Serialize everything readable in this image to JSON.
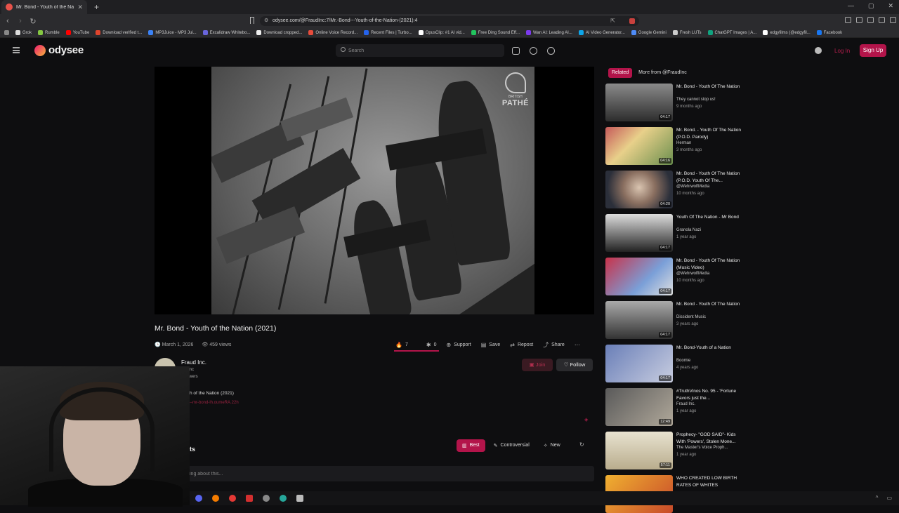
{
  "browser": {
    "tab_title": "Mr. Bond - Youth of the Natio",
    "url": "odysee.com/@FraudInc:7/Mr.-Bond---Youth-of-the-Nation-(2021):4",
    "bookmarks": [
      {
        "label": "Grok",
        "color": "#dddddd"
      },
      {
        "label": "Rumble",
        "color": "#85c742"
      },
      {
        "label": "YouTube",
        "color": "#ff0000"
      },
      {
        "label": "Download verified t...",
        "color": "#e0452d"
      },
      {
        "label": "MP3Juice - MP3 Jui...",
        "color": "#3b82f6"
      },
      {
        "label": "Excalidraw Whitebo...",
        "color": "#6965db"
      },
      {
        "label": "Download cropped...",
        "color": "#eeeeee"
      },
      {
        "label": "Online Voice Record...",
        "color": "#e74c3c"
      },
      {
        "label": "Recent Files | Turbo...",
        "color": "#2563eb"
      },
      {
        "label": "OpusClip: #1 AI vid...",
        "color": "#ffffff"
      },
      {
        "label": "Free Ding Sound Eff...",
        "color": "#22c55e"
      },
      {
        "label": "Wan AI: Leading AI...",
        "color": "#7c3aed"
      },
      {
        "label": "AI Video Generator...",
        "color": "#0ea5e9"
      },
      {
        "label": "Google Gemini",
        "color": "#4f8cf7"
      },
      {
        "label": "Fresh LUTs",
        "color": "#cccccc"
      },
      {
        "label": "ChatGPT Images | A...",
        "color": "#10a37f"
      },
      {
        "label": "edgyfilms (@edgyfil...",
        "color": "#ffffff"
      },
      {
        "label": "Facebook",
        "color": "#1877f2"
      }
    ]
  },
  "header": {
    "logo_text": "odysee",
    "search_placeholder": "Search",
    "login": "Log In",
    "signup": "Sign Up"
  },
  "video": {
    "title": "Mr. Bond - Youth of the Nation (2021)",
    "date": "March 1, 2026",
    "views": "459 views",
    "watermark": {
      "small": "BRITISH",
      "brand": "PATHÉ"
    },
    "actions": {
      "likes": "7",
      "dislikes": "0",
      "support": "Support",
      "save": "Save",
      "repost": "Repost",
      "share": "Share"
    }
  },
  "channel": {
    "name": "Fraud Inc.",
    "handle": "audInc",
    "followers": "followers",
    "join": "Join",
    "follow": "Follow"
  },
  "description": {
    "text": "h of the Nation (2021)",
    "link": "--mr-bond-lh.oumeRA.22h"
  },
  "comments": {
    "heading": "ts",
    "sort": [
      "Best",
      "Controversial",
      "New"
    ],
    "placeholder": "ing about this..."
  },
  "sidebar": {
    "tabs": [
      "Related",
      "More from @FraudInc"
    ],
    "items": [
      {
        "title": "Mr. Bond - Youth Of The Nation",
        "channel": "They cannot stop us!",
        "time": "9 months ago",
        "duration": "04:17",
        "thumb": "crowd"
      },
      {
        "title": "Mr. Bond. - Youth Of The Nation (P.O.D. Parody)",
        "channel": "Herman",
        "time": "3 months ago",
        "duration": "04:16",
        "thumb": "flowers"
      },
      {
        "title": "Mr. Bond - Youth Of The Nation (P.O.D. Youth Of The...",
        "channel": "@WehrwolfMedia",
        "time": "10 months ago",
        "duration": "04:20",
        "thumb": "face"
      },
      {
        "title": "Youth Of The Nation - Mr Bond",
        "channel": "Granola Nazi",
        "time": "1 year ago",
        "duration": "04:17",
        "thumb": "salute"
      },
      {
        "title": "Mr. Bond - Youth Of The Nation (Music Video)",
        "channel": "@WehrwolfMedia",
        "time": "10 months ago",
        "duration": "04:17",
        "thumb": "banner"
      },
      {
        "title": "Mr. Bond - Youth Of The Nation",
        "channel": "Dissident Music",
        "time": "3 years ago",
        "duration": "04:17",
        "thumb": "march"
      },
      {
        "title": "Mr. Bond-Youth of a Nation",
        "channel": "Boomie",
        "time": "4 years ago",
        "duration": "04:17",
        "thumb": "blur"
      },
      {
        "title": "#TruthVinos No. 95 - 'Fortune Favors just the...",
        "channel": "Fraud Inc.",
        "time": "1 year ago",
        "duration": "12:49",
        "thumb": "uniform"
      },
      {
        "title": "Prophecy- \"GOD SAID\"- Kids With 'Powers', Stolen Mone...",
        "channel": "The Master's Voice Proph...",
        "time": "1 year ago",
        "duration": "57:11",
        "thumb": "godsaid"
      },
      {
        "title": "WHO CREATED LOW BIRTH RATES OF WHITES",
        "channel": "",
        "time": "",
        "duration": "",
        "thumb": "who"
      }
    ]
  }
}
